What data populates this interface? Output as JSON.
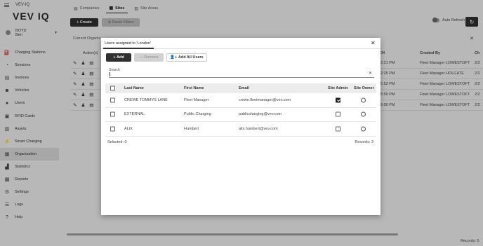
{
  "app": {
    "title": "VEV-IQ",
    "logo": "VEV IQ"
  },
  "user": {
    "line1": "BOYD",
    "line2": "Ben"
  },
  "sidebar": {
    "items": [
      {
        "label": "Charging Stations",
        "icon": "charging-station-icon"
      },
      {
        "label": "Sessions",
        "icon": "sessions-icon"
      },
      {
        "label": "Invoices",
        "icon": "invoice-icon"
      },
      {
        "label": "Vehicles",
        "icon": "car-icon"
      },
      {
        "label": "Users",
        "icon": "users-icon"
      },
      {
        "label": "RFID Cards",
        "icon": "rfid-card-icon"
      },
      {
        "label": "Assets",
        "icon": "assets-icon"
      },
      {
        "label": "Smart Charging",
        "icon": "bolt-icon"
      },
      {
        "label": "Organization",
        "icon": "organization-icon",
        "active": true
      },
      {
        "label": "Statistics",
        "icon": "statistics-icon"
      },
      {
        "label": "Reports",
        "icon": "reports-icon"
      },
      {
        "label": "Settings",
        "icon": "gear-icon"
      },
      {
        "label": "Logs",
        "icon": "logs-icon"
      },
      {
        "label": "Help",
        "icon": "help-icon"
      }
    ]
  },
  "tabs": [
    {
      "label": "Companies",
      "icon": "company-icon"
    },
    {
      "label": "Sites",
      "icon": "sites-icon",
      "active": true
    },
    {
      "label": "Site Areas",
      "icon": "site-areas-icon"
    }
  ],
  "toolbar": {
    "create_label": "Create",
    "reset_label": "Reset Filters",
    "auto_refresh_label": "Auto Refresh"
  },
  "background": {
    "section_title": "Current Organiz",
    "columns": {
      "actions": "Action(s)",
      "ch": "CH",
      "created_by": "Created By",
      "ch_right": "Ch"
    },
    "rows": [
      {
        "time": "2:21 PM",
        "creator": "Fleet Manager LOWESTOFT",
        "num": "2/2"
      },
      {
        "time": "2:25 PM",
        "creator": "Fleet Manager HOLGATE",
        "num": "2/2"
      },
      {
        "time": "5:52 PM",
        "creator": "Fleet Manager LOWESTOFT",
        "num": "2/2"
      },
      {
        "time": "5:59 PM",
        "creator": "Fleet Manager LOWESTOFT",
        "num": "2/2"
      },
      {
        "time": "6:00 PM",
        "creator": "Fleet Manager LOWESTOFT",
        "num": "2/2"
      }
    ],
    "records_label": "Records: 5"
  },
  "modal": {
    "title": "Users assigned to 'London'",
    "add_label": "Add",
    "remove_label": "Remove",
    "add_all_label": "Add All Users",
    "search_label": "Search",
    "search_value": "",
    "columns": {
      "last_name": "Last Name",
      "first_name": "First Name",
      "email": "Email",
      "site_admin": "Site Admin",
      "site_owner": "Site Owner"
    },
    "rows": [
      {
        "last_name": "CREWE TOMMYS LANE",
        "first_name": "Fleet Manager",
        "email": "crewe.fleetmanager@vev.com",
        "site_admin": true,
        "site_owner": false
      },
      {
        "last_name": "EXTERNAL",
        "first_name": "Public Charging",
        "email": "publiccharging@vev.com",
        "site_admin": false,
        "site_owner": false
      },
      {
        "last_name": "ALIX",
        "first_name": "Humbert",
        "email": "alix.humbert@vev.com",
        "site_admin": false,
        "site_owner": false
      }
    ],
    "selected_label": "Selected: 0",
    "records_label": "Records: 3"
  }
}
